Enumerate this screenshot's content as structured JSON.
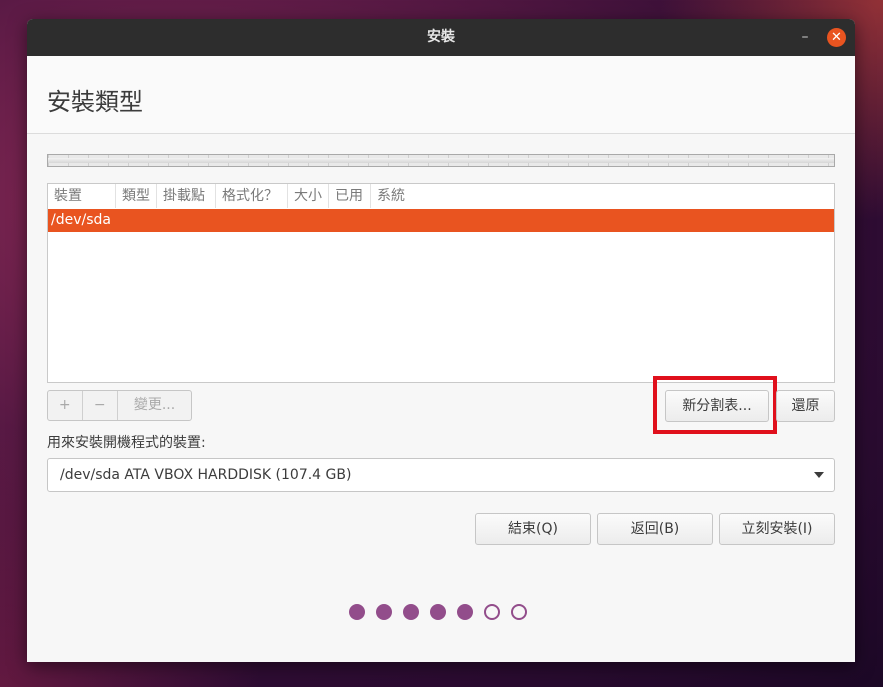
{
  "window": {
    "title": "安裝",
    "minimize_glyph": "–",
    "close_glyph": "✕"
  },
  "page": {
    "title": "安裝類型"
  },
  "table": {
    "columns": [
      "裝置",
      "類型",
      "掛載點",
      "格式化？",
      "大小",
      "已用",
      "系統"
    ],
    "rows": [
      {
        "device": "/dev/sda",
        "selected": true
      }
    ]
  },
  "controls": {
    "add_label": "+",
    "remove_label": "−",
    "change_label": "變更...",
    "new_table_label": "新分割表...",
    "revert_label": "還原"
  },
  "boot": {
    "label": "用來安裝開機程式的裝置:",
    "selected_device": "/dev/sda ATA VBOX HARDDISK (107.4 GB)"
  },
  "footer": {
    "quit_label": "結束(Q)",
    "back_label": "返回(B)",
    "install_label": "立刻安裝(I)"
  },
  "progress": {
    "total_steps": 7,
    "completed_steps": 5
  },
  "colors": {
    "accent": "#e95420",
    "progress_dot": "#924d8b",
    "highlight": "#e0101c"
  },
  "icons": [
    "minimize-icon",
    "close-icon",
    "chevron-down-icon"
  ]
}
